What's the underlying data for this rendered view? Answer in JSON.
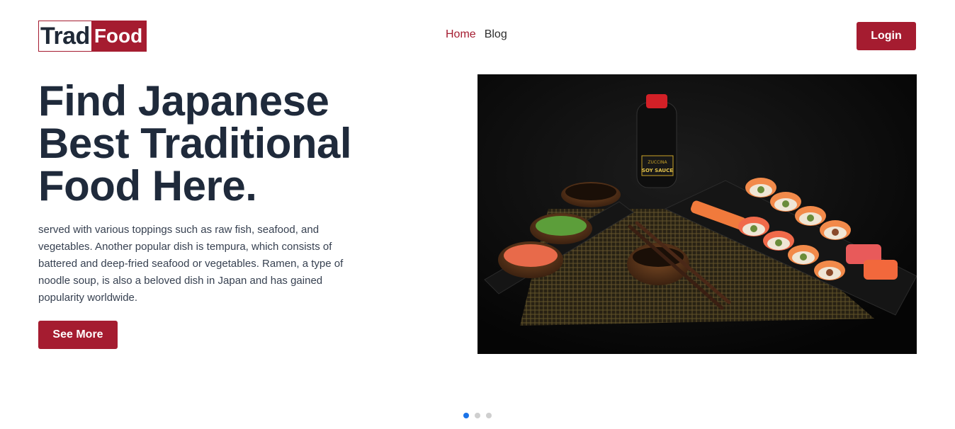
{
  "header": {
    "logo": {
      "part1": "Trad",
      "part2": "Food"
    },
    "nav": [
      {
        "label": "Home",
        "active": true
      },
      {
        "label": "Blog",
        "active": false
      }
    ],
    "login_label": "Login"
  },
  "hero": {
    "title_lines": [
      "Find Japanese",
      "Best Traditional",
      "Food Here."
    ],
    "description": "served with various toppings such as raw fish, seafood, and vegetables. Another popular dish is tempura, which consists of battered and deep-fried seafood or vegetables. Ramen, a type of noodle soup, is also a beloved dish in Japan and has gained popularity worldwide.",
    "cta_label": "See More",
    "image": {
      "bottle_brand": "ZUCCINA",
      "bottle_label": "SOY SAUCE"
    }
  },
  "carousel": {
    "slides": 3,
    "active_index": 0
  },
  "colors": {
    "brand": "#a51c30",
    "text_dark": "#1f2a3b",
    "dot_active": "#1a73e8"
  }
}
